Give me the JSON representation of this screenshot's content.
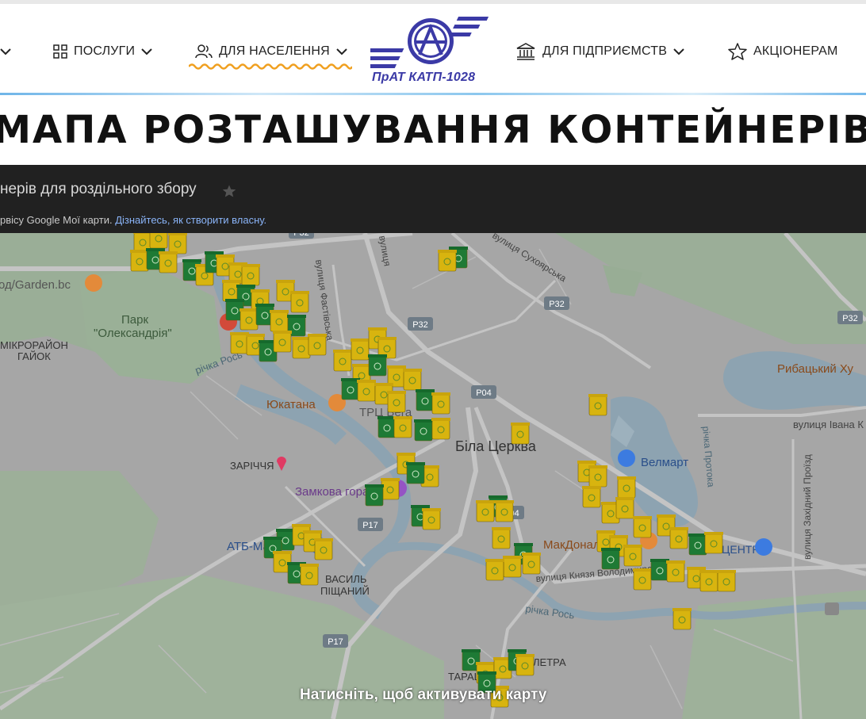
{
  "header": {
    "nav": [
      {
        "label": "ПОСЛУГИ",
        "icon": "grid-icon"
      },
      {
        "label": "ДЛЯ НАСЕЛЕННЯ",
        "icon": "users-icon"
      },
      {
        "label": "ДЛЯ ПІДПРИЄМСТВ",
        "icon": "bank-icon"
      },
      {
        "label": "АКЦІОНЕРАМ",
        "icon": "star-icon"
      }
    ],
    "logo_text": "ПрАТ КАТП-1028",
    "active_accent": "#f0a020"
  },
  "page": {
    "title": "МАПА РОЗТАШУВАННЯ КОНТЕЙНЕРІВ"
  },
  "map": {
    "header_title": "нерів для роздільного збору",
    "header_sub_prefix": "рвісу Google Мої карти. ",
    "header_sub_link": "Дізнайтесь, як створити власну.",
    "activate_text": "Натисніть, щоб активувати карту",
    "labels": {
      "garden": "од/Garden.bc",
      "park1": "Парк",
      "park2": "\"Олександрія\"",
      "mikro1": "МІКРОРАЙОН",
      "mikro2": "ГАЙОК",
      "river1": "річка Рось",
      "river2": "річка Рось",
      "yukatana": "Юкатана",
      "trc": "ТРЦ Вега",
      "zarichya": "ЗАРІЧЧЯ",
      "zamkova": "Замкова гора",
      "bila": "Біла Церква",
      "velmart": "Велмарт",
      "mcdon": "МакДональдз",
      "atb": "АТБ-Маркет",
      "tarash": "ТАРАЩ",
      "letra": "ЛЕТРА",
      "vpis1": "ВАСИЛЬ",
      "vpis2": "ПІЩАНИЙ",
      "rybatskyi": "Рибацький Ху",
      "vul_ivana": "вулиця Івана К",
      "vul_sukho": "вулиця Сухоярська",
      "vul_fastiv": "вулиця Фастівська",
      "vul_zakh": "вулиця Західний Проїзд",
      "vul_knyazya": "вулиця Князя Володимира",
      "richka_protoka": "річка Протока",
      "vulytsia": "вулиця",
      "centr": "ЦЕНТР",
      "p32a": "P32",
      "p32b": "P32",
      "p32c": "P32",
      "p32d": "P32",
      "p04": "P04",
      "p17a": "P17",
      "p17b": "P17",
      "p04b": "P04"
    },
    "colors": {
      "land": "#a7a7a7",
      "water": "#8fa6b3",
      "park": "#9aae97",
      "road": "#c7c7c7",
      "container_yellow": "#d8b40f",
      "container_green": "#1e7a35"
    }
  }
}
